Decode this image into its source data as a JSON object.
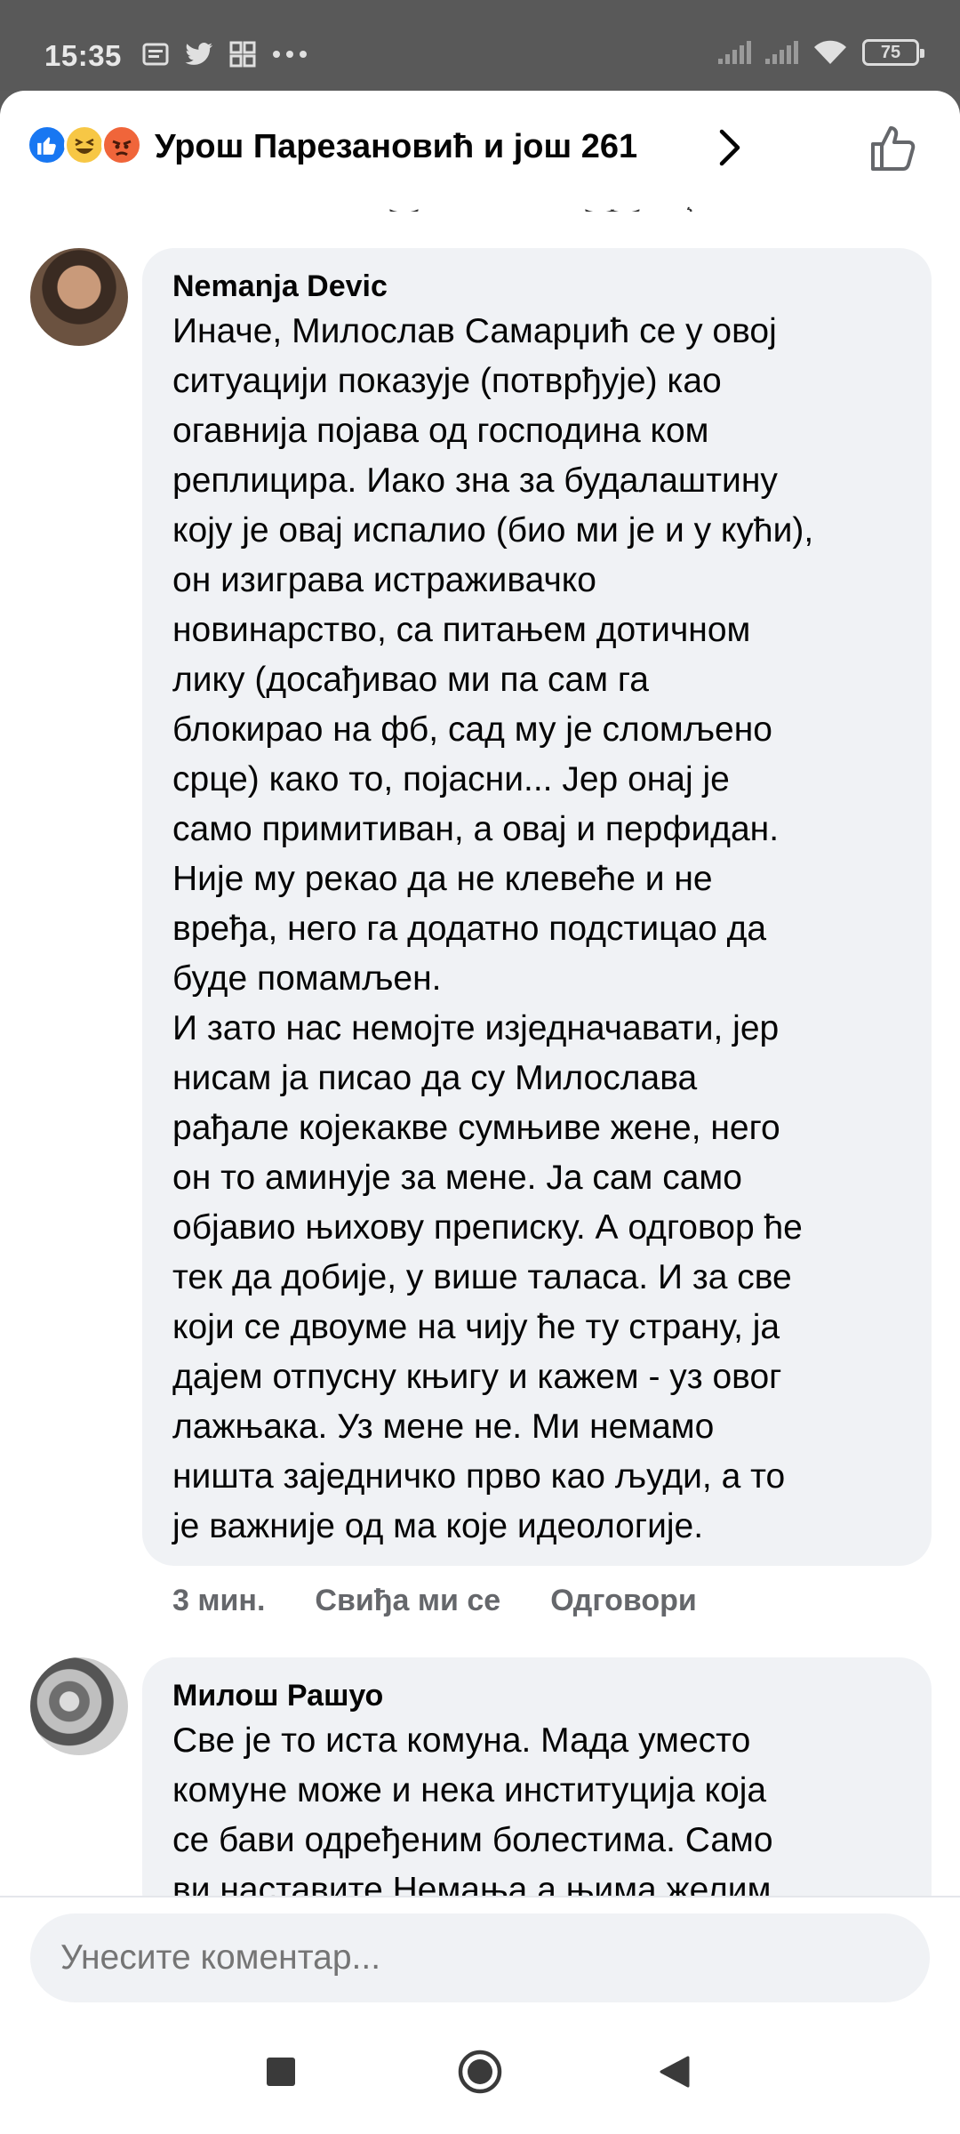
{
  "status_bar": {
    "time": "15:35",
    "battery": "75",
    "icons": [
      "notification-icon",
      "twitter-icon",
      "apps-icon",
      "more-dots-icon",
      "signal-icon",
      "signal-icon",
      "wifi-icon",
      "battery-icon"
    ]
  },
  "header": {
    "title": "Урош Парезановић и још 261",
    "reaction_icons": [
      "like-reaction",
      "haha-reaction",
      "angry-reaction"
    ]
  },
  "comments": [
    {
      "author": "Nemanja Devic",
      "lines": [
        "Иначе, Милослав Самарџић се у овој",
        "ситуацији показује (потврђује) као",
        "огавнија појава од господина ком",
        "реплицира. Иако зна за будалаштину",
        "коју је овај испалио (био ми је и у кући),",
        "он изиграва истраживачко",
        "новинарство, са питањем дотичном",
        "лику (досађивао ми па сам га",
        "блокирао на фб, сад му је сломљено",
        "срце) како то, појасни... Јер онај је",
        "само примитиван, а овај и перфидан.",
        "Није му рекао да не клевеће и не",
        "вређа, него га додатно подстицао да",
        "буде помамљен.",
        "И зато нас немојте изједначавати, јер",
        "нисам ја писао да су Милослава",
        "рађале којекакве сумњиве жене, него",
        "он то аминује за мене. Ја сам само",
        "објавио њихову преписку. А одговор ће",
        "тек да добије, у више таласа. И за све",
        "који се двоуме на чију ће ту страну, ја",
        "дајем отпусну књигу и кажем - уз овог",
        "лажњака. Уз мене не. Ми немамо",
        "ништа заједничко прво као људи, а то",
        "је важније од ма које идеологије."
      ],
      "time": "3 мин.",
      "like_label": "Свиђа ми се",
      "reply_label": "Одговори"
    },
    {
      "author": "Милош Рашуо",
      "lines": [
        "Све је то иста комуна. Мада уместо",
        "комуне може и нека институција која",
        "се бави одређеним болестима. Само",
        "ви наставите Немања а њима желим"
      ]
    }
  ],
  "composer": {
    "placeholder": "Унесите коментар..."
  },
  "nav": {
    "buttons": [
      "recents-button",
      "home-button",
      "back-button"
    ]
  }
}
